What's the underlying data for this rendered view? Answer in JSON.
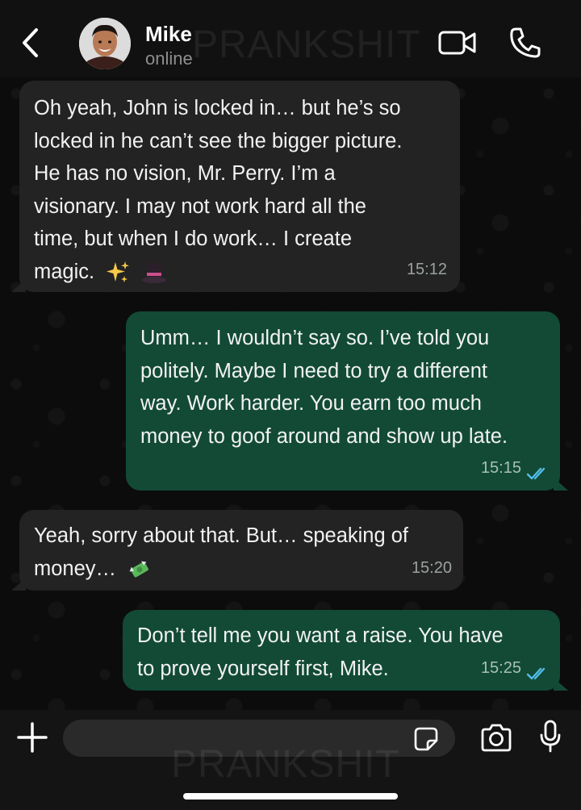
{
  "header": {
    "contact_name": "Mike",
    "status": "online",
    "watermark": "PRANKSHIT"
  },
  "messages": [
    {
      "direction": "incoming",
      "text": "Oh yeah, John is locked in… but he’s so\nlocked in he can’t see the bigger picture.\nHe has no vision, Mr. Perry. I’m a\nvisionary. I may not work hard all the\ntime, but when I do work… I create\nmagic.",
      "emojis": [
        "sparkles",
        "top-hat"
      ],
      "time": "15:12"
    },
    {
      "direction": "outgoing",
      "text": "Umm… I wouldn’t say so. I’ve told you\npolitely. Maybe I need to try a different\nway. Work harder. You earn too much\nmoney to goof around and show up late.",
      "time": "15:15",
      "status": "read"
    },
    {
      "direction": "incoming",
      "text": "Yeah, sorry about that. But… speaking of\nmoney…",
      "emojis": [
        "money-with-wings"
      ],
      "time": "15:20"
    },
    {
      "direction": "outgoing",
      "text": "Don’t tell me you want a raise. You have\nto prove yourself first, Mike.",
      "time": "15:25",
      "status": "read"
    }
  ],
  "composer": {
    "value": "",
    "placeholder": ""
  },
  "colors": {
    "incoming_bubble": "#232323",
    "outgoing_bubble": "#124a36",
    "read_ticks": "#53bdeb",
    "header_bg": "#111111"
  },
  "icons": [
    "back-arrow",
    "video-camera",
    "phone",
    "plus",
    "sticker",
    "camera",
    "microphone"
  ]
}
